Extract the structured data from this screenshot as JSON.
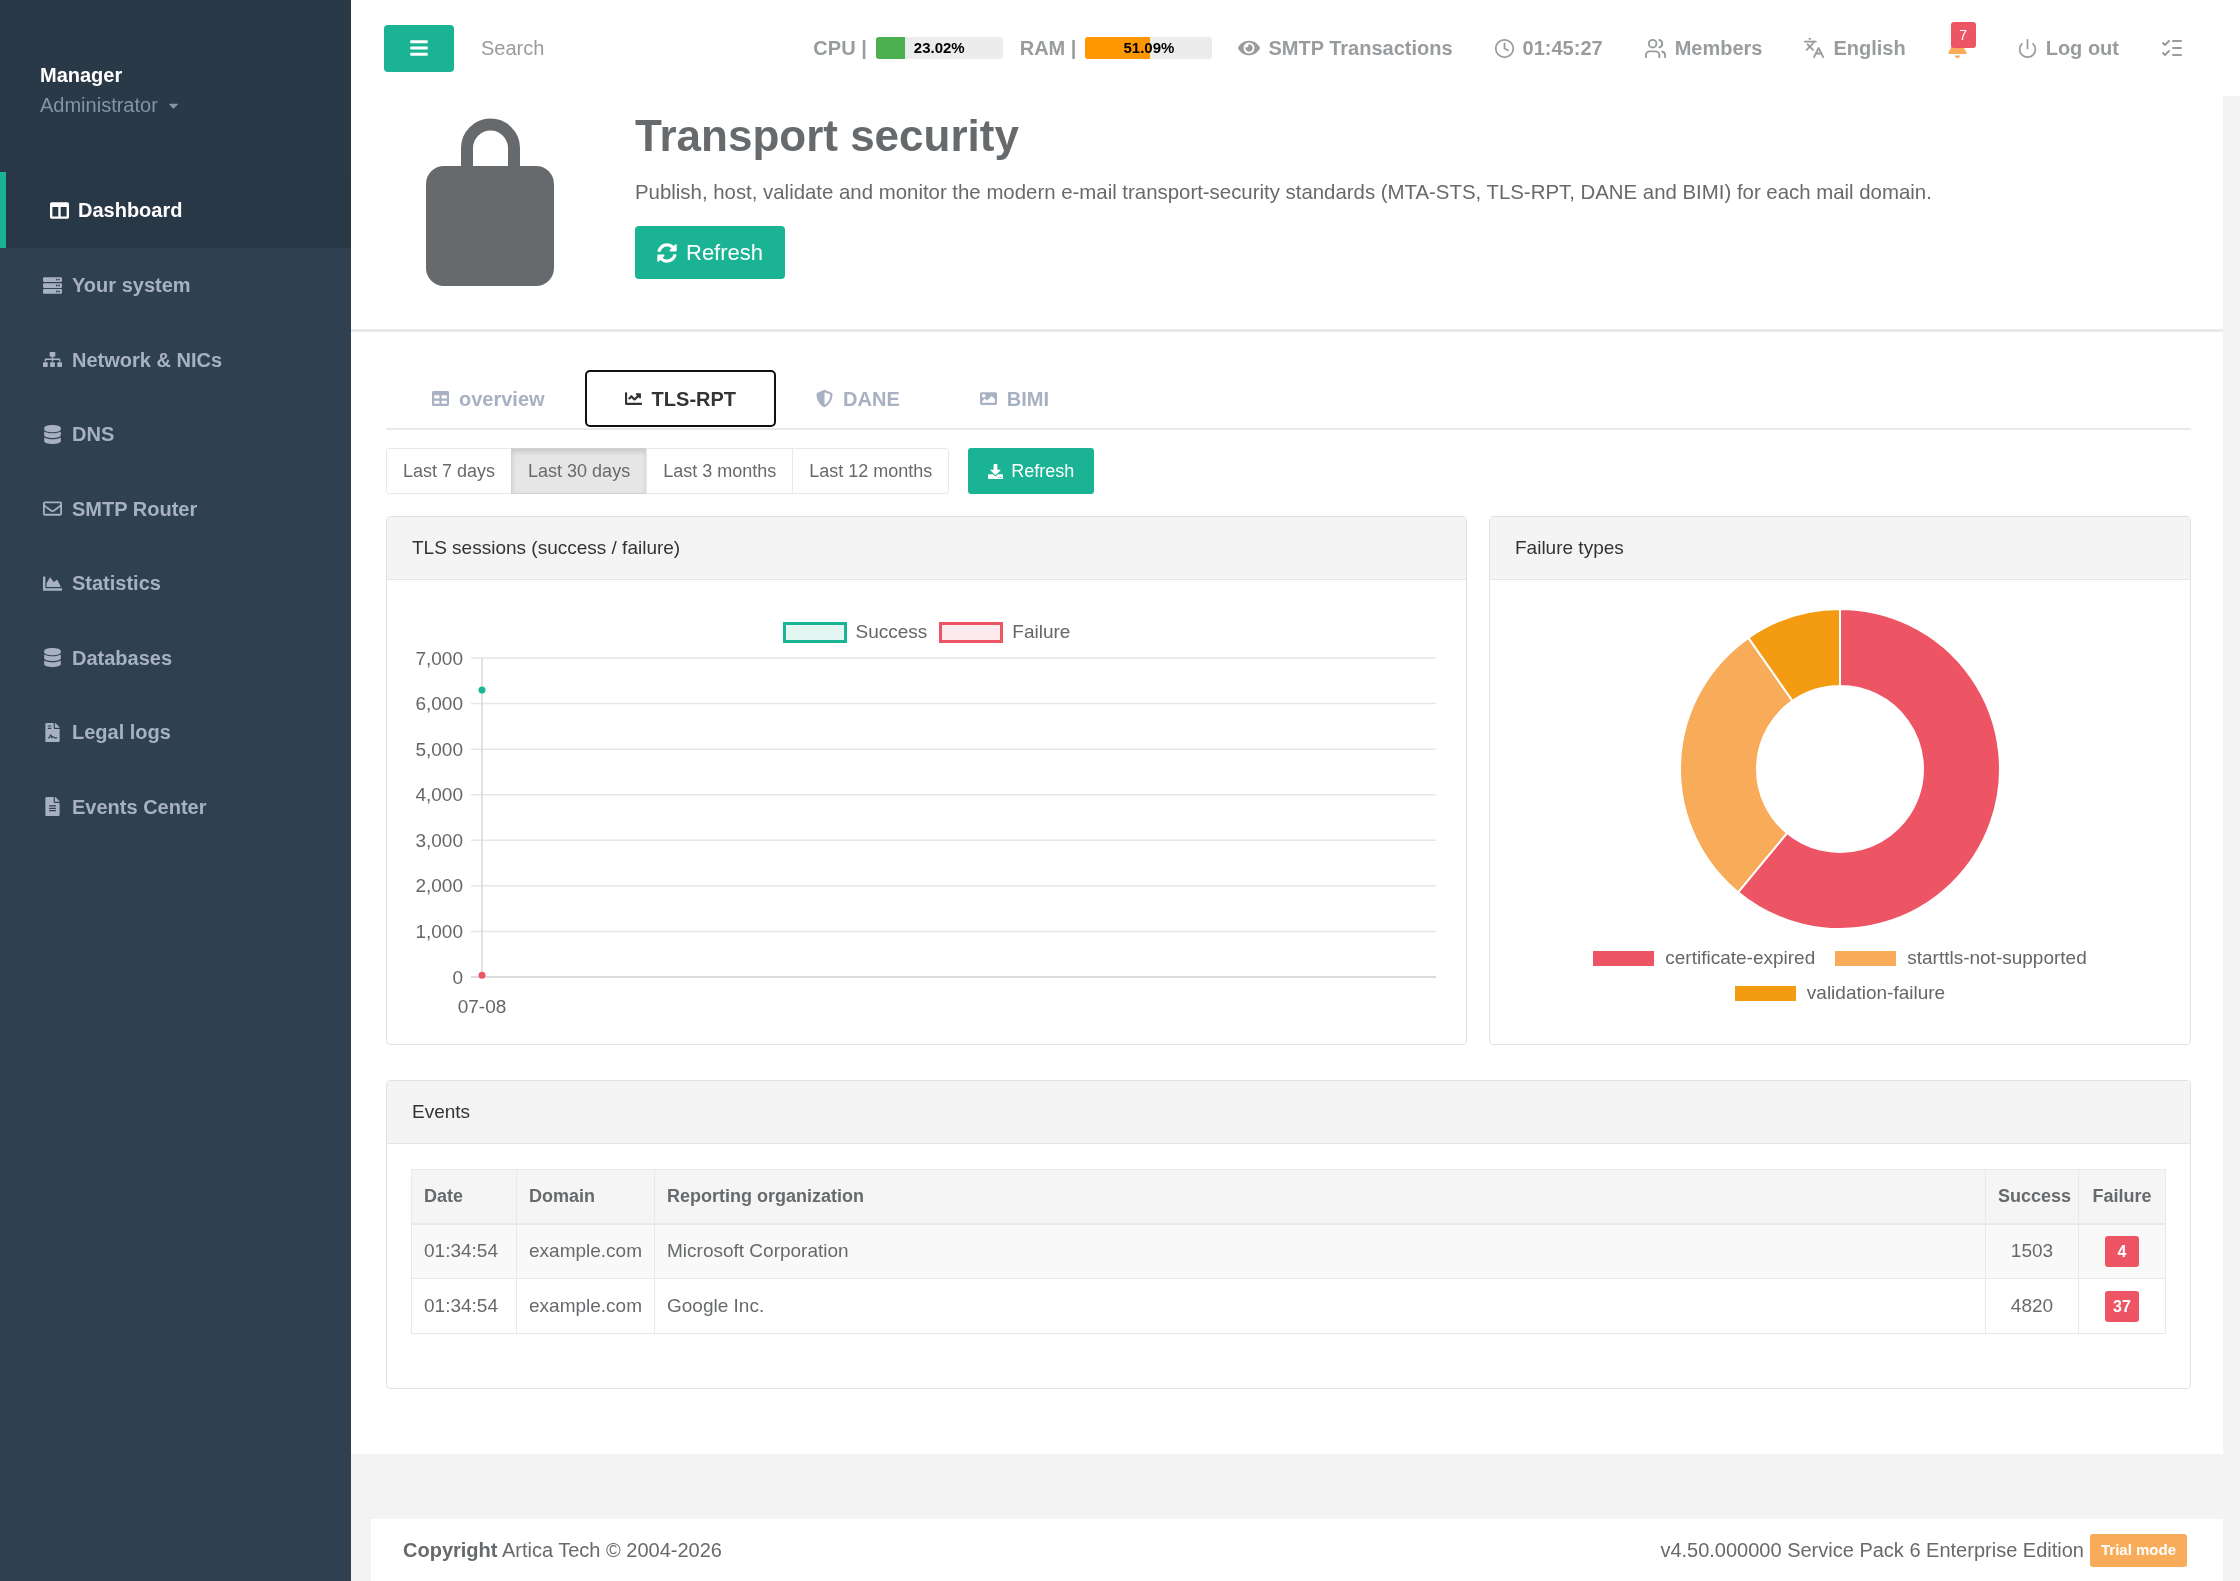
{
  "sidebar": {
    "user": {
      "name": "Manager",
      "role": "Administrator"
    },
    "items": [
      {
        "label": "Dashboard",
        "selected": true
      },
      {
        "label": "Your system",
        "selected": false
      },
      {
        "label": "Network & NICs",
        "selected": false
      },
      {
        "label": "DNS",
        "selected": false
      },
      {
        "label": "SMTP Router",
        "selected": false
      },
      {
        "label": "Statistics",
        "selected": false
      },
      {
        "label": "Databases",
        "selected": false
      },
      {
        "label": "Legal logs",
        "selected": false
      },
      {
        "label": "Events Center",
        "selected": false
      }
    ]
  },
  "topbar": {
    "search": {
      "placeholder": "Search"
    },
    "meters": [
      {
        "label": "CPU |",
        "reading": "23.02%",
        "level": 0.2302,
        "color": "#4caf50"
      },
      {
        "label": "RAM |",
        "reading": "51.09%",
        "level": 0.5109,
        "color": "#ff9800"
      }
    ],
    "links": [
      "SMTP Transactions",
      "01:45:27",
      "Members",
      "English"
    ],
    "notifications": {
      "count": "7"
    },
    "logout": {
      "label": "Log out"
    }
  },
  "header": {
    "title": "Transport security",
    "description": "Publish, host, validate and monitor the modern e-mail transport-security standards (MTA-STS, TLS-RPT, DANE and BIMI) for each mail domain.",
    "button": "Refresh"
  },
  "tabs": [
    {
      "label": "overview",
      "selected": false
    },
    {
      "label": "TLS-RPT",
      "selected": true
    },
    {
      "label": "DANE",
      "selected": false
    },
    {
      "label": "BIMI",
      "selected": false
    }
  ],
  "ranges": {
    "items": [
      {
        "label": "Last 7 days",
        "selected": false
      },
      {
        "label": "Last 30 days",
        "selected": true
      },
      {
        "label": "Last 3 months",
        "selected": false
      },
      {
        "label": "Last 12 months",
        "selected": false
      }
    ],
    "button": "Refresh"
  },
  "sessions_panel": {
    "title": "TLS sessions (success / failure)",
    "chart_data": {
      "type": "line",
      "categories": [
        "07-08"
      ],
      "series": [
        {
          "name": "Success",
          "color": "#1ab394",
          "marker": "circle",
          "values": [
            6300
          ]
        },
        {
          "name": "Failure",
          "color": "#ed5565",
          "marker": "circle",
          "values": [
            40
          ]
        }
      ],
      "ylim": [
        0,
        7000
      ],
      "yticks": [
        0,
        {
          "value": 1000,
          "label": "1,000"
        },
        {
          "value": 2000,
          "label": "2,000"
        },
        {
          "value": 3000,
          "label": "3,000"
        },
        {
          "value": 4000,
          "label": "4,000"
        },
        {
          "value": 5000,
          "label": "5,000"
        },
        {
          "value": 6000,
          "label": "6,000"
        },
        {
          "value": 7000,
          "label": "7,000"
        }
      ],
      "grid": true,
      "legend": "top"
    }
  },
  "failure_panel": {
    "title": "Failure types",
    "chart_data": {
      "type": "donut",
      "categories": [
        "certificate-expired",
        "starttls-not-supported",
        "validation-failure"
      ],
      "series": [
        {
          "values": [
            61,
            29.3,
            9.7
          ],
          "colors": [
            "#ed5565",
            "#f8ac59",
            "#f39c12"
          ]
        }
      ],
      "legend": "bottom"
    }
  },
  "events": {
    "title": "Events",
    "columns": [
      "Date",
      "Domain",
      "Reporting organization",
      "Success",
      "Failure"
    ],
    "rows": [
      [
        "01:34:54",
        "example.com",
        "Microsoft Corporation",
        "1503",
        "4"
      ],
      [
        "01:34:54",
        "example.com",
        "Google Inc.",
        "4820",
        "37"
      ]
    ]
  },
  "footer": {
    "copyright": "**Copyright** Artica Tech © 2004-2026",
    "version": "v4.50.000000 Service Pack 6 Enterprise Edition",
    "badge": "Trial mode"
  }
}
